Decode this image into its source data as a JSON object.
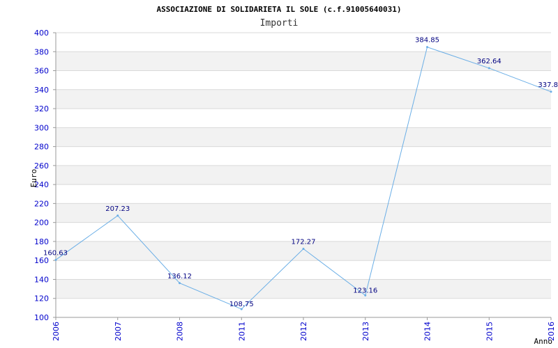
{
  "chart_data": {
    "type": "line",
    "title": "ASSOCIAZIONE DI SOLIDARIETA IL SOLE (c.f.91005640031)",
    "subtitle": "Importi",
    "xlabel": "Anno",
    "ylabel": "Euro",
    "categories": [
      "2006",
      "2007",
      "2008",
      "2011",
      "2012",
      "2013",
      "2014",
      "2015",
      "2016"
    ],
    "series": [
      {
        "values": [
          160.63,
          207.23,
          136.12,
          108.75,
          172.27,
          123.16,
          384.85,
          362.64,
          337.8
        ],
        "labels": [
          "160.63",
          "207.23",
          "136.12",
          "108.75",
          "172.27",
          "123.16",
          "384.85",
          "362.64",
          "337.8"
        ]
      }
    ],
    "ylim": [
      100,
      400
    ],
    "y_ticks": [
      "100",
      "120",
      "140",
      "160",
      "180",
      "200",
      "220",
      "240",
      "260",
      "280",
      "300",
      "320",
      "340",
      "360",
      "380",
      "400"
    ],
    "grid": true,
    "colors": {
      "line": "#6aaee6",
      "band": "#f2f2f2",
      "grid": "#d9d9d9",
      "tick_label": "#0000cc",
      "data_label": "#000080"
    }
  }
}
